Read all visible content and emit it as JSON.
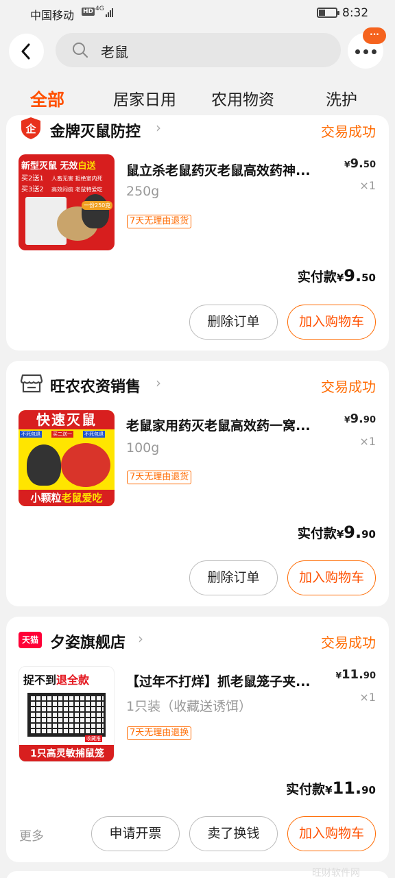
{
  "status_bar": {
    "carrier": "中国移动",
    "hd": "HD",
    "signal": "4G",
    "time": "8:32"
  },
  "search": {
    "query": "老鼠"
  },
  "more_badge": "···",
  "tabs": [
    "全部",
    "居家日用",
    "农用物资",
    "洗护"
  ],
  "orders": [
    {
      "shop": "金牌灭鼠防控",
      "shop_icon": "enterprise-shield-icon",
      "status": "交易成功",
      "title": "鼠立杀老鼠药灭老鼠高效药神...",
      "spec": "250g",
      "tag": "7天无理由退货",
      "price_int": "9.",
      "price_dec": "50",
      "qty": "×1",
      "paid_label": "实付款",
      "paid_int": "9.",
      "paid_dec": "50",
      "thumb_text": {
        "top": "新型灭鼠 无效",
        "top_hl": "白送",
        "l1": "买2送1",
        "l2": "买3送2",
        "d1": "人畜无害 拒绝室内死",
        "d2": "高效闷痰 老鼠特爱吃",
        "badge": "一份250克"
      },
      "buttons": [
        "删除订单",
        "加入购物车"
      ]
    },
    {
      "shop": "旺农农资销售",
      "shop_icon": "store-icon",
      "status": "交易成功",
      "title": "老鼠家用药灭老鼠高效药一窝...",
      "spec": "100g",
      "tag": "7天无理由退货",
      "price_int": "9.",
      "price_dec": "90",
      "qty": "×1",
      "paid_label": "实付款",
      "paid_int": "9.",
      "paid_dec": "90",
      "thumb_text": {
        "top": "快速灭鼠",
        "b1": "不死包退",
        "b2": "买二送一",
        "b3": "不死包退",
        "bottom": "小颗粒",
        "bottom_hl": "老鼠爱吃"
      },
      "buttons": [
        "删除订单",
        "加入购物车"
      ]
    },
    {
      "shop": "夕姿旗舰店",
      "shop_icon": "tmall-icon",
      "shop_icon_text": "天猫",
      "status": "交易成功",
      "title": "【过年不打烊】抓老鼠笼子夹...",
      "spec": "1只装（收藏送诱饵）",
      "tag": "7天无理由退换",
      "price_int": "11.",
      "price_dec": "90",
      "qty": "×1",
      "paid_label": "实付款",
      "paid_int": "11.",
      "paid_dec": "90",
      "thumb_text": {
        "top": "捉不到",
        "top_hl": "退全款",
        "bottom": "1只高灵敏捕鼠笼",
        "badge": "收藏推"
      },
      "more": "更多",
      "buttons": [
        "申请开票",
        "卖了换钱",
        "加入购物车"
      ]
    }
  ],
  "currency": "¥",
  "watermark": "旺财软件网",
  "colors": {
    "accent": "#ff5000",
    "status": "#ff6a00",
    "background": "#f2f2f2"
  }
}
